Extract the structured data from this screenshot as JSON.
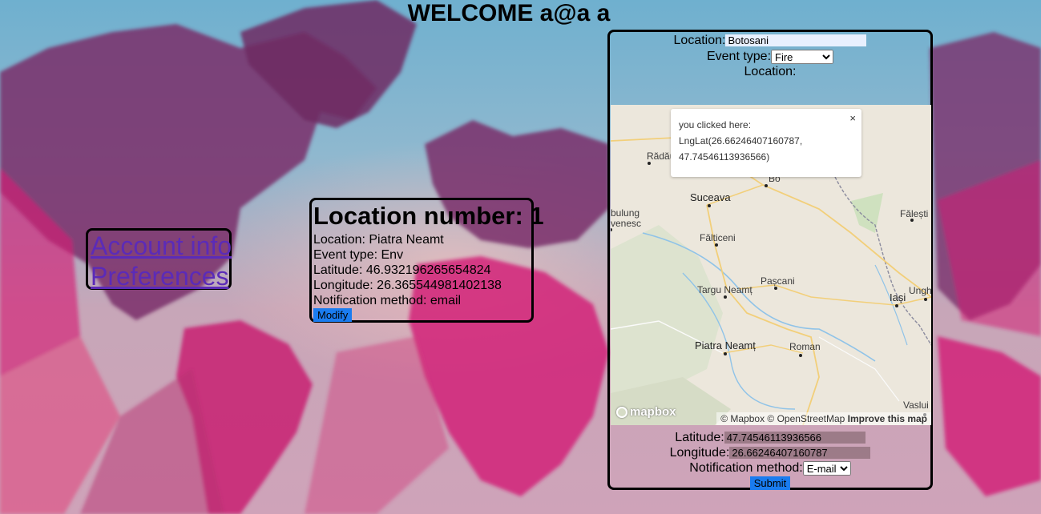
{
  "header": {
    "welcome": "WELCOME a@a a"
  },
  "sidebar": {
    "account_info": "Account info",
    "preferences": "Preferences"
  },
  "location_card": {
    "heading": "Location number: 1",
    "location": "Location: Piatra Neamt",
    "event_type": "Event type: Env",
    "latitude": "Latitude: 46.932196265654824",
    "longitude": "Longitude: 26.365544981402138",
    "notification": "Notification method: email",
    "modify_label": "Modify"
  },
  "form": {
    "location_label": "Location:",
    "location_value": "Botosani",
    "event_type_label": "Event type:",
    "event_type_selected": "Fire",
    "map_location_label": "Location:",
    "latitude_label": "Latitude:",
    "latitude_value": "47.74546113936566",
    "longitude_label": "Longitude:",
    "longitude_value": "26.66246407160787",
    "notification_label": "Notification method:",
    "notification_selected": "E-mail",
    "submit_label": "Submit"
  },
  "map": {
    "popup": {
      "line1": "you clicked here:",
      "line2": "LngLat(26.66246407160787,",
      "line3": "47.74546113936566)",
      "close": "×"
    },
    "cities": {
      "radauti": "Rădăuți",
      "suceava": "Suceava",
      "falesti": "Fălești",
      "campulung": "bulung",
      "moldovenesc": "venesc",
      "falticeni": "Fălticeni",
      "targu_neamt": "Targu Neamț",
      "pascani": "Pașcani",
      "iasi": "Iași",
      "ungheni": "Ungh",
      "piatra_neamt": "Piatra Neamț",
      "roman": "Roman",
      "vaslui": "Vaslui",
      "botosani": "Bo"
    },
    "attribution": "© Mapbox © OpenStreetMap",
    "improve": "Improve this map",
    "logo": "mapbox"
  },
  "colors": {
    "button": "#1a7cf0",
    "link": "#5b2bb8",
    "continent": "#7a2f6a"
  }
}
